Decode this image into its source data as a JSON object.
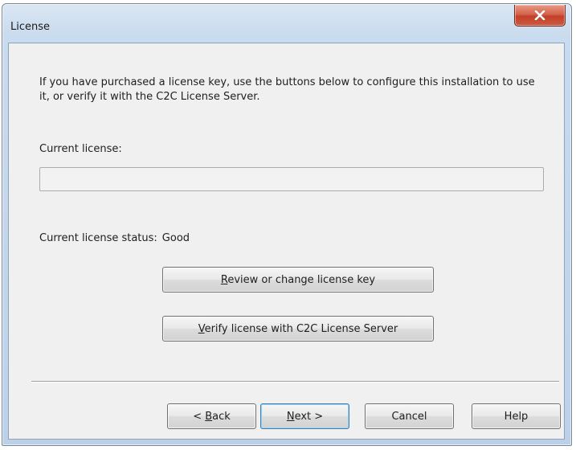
{
  "window": {
    "title": "License",
    "close_icon": "close-x-icon"
  },
  "content": {
    "intro_text": "If you have purchased a license key, use the buttons below to configure this installation to use it, or verify it with the C2C License Server.",
    "current_license_label": "Current license:",
    "current_license_value": "",
    "status_label": "Current license status:",
    "status_value": "Good"
  },
  "buttons": {
    "review": {
      "label": "Review or change license key",
      "mnemonic": "R"
    },
    "verify": {
      "label": "Verify license with C2C License Server",
      "mnemonic": "V"
    },
    "back": {
      "label": "< Back",
      "mnemonic": "B"
    },
    "next": {
      "label": "Next >",
      "mnemonic": "N"
    },
    "cancel": {
      "label": "Cancel"
    },
    "help": {
      "label": "Help"
    }
  },
  "colors": {
    "close_button": "#c9472f",
    "window_frame": "#c9dbee",
    "dialog_background": "#f0f0f0",
    "default_button_border": "#3c7fb1"
  }
}
